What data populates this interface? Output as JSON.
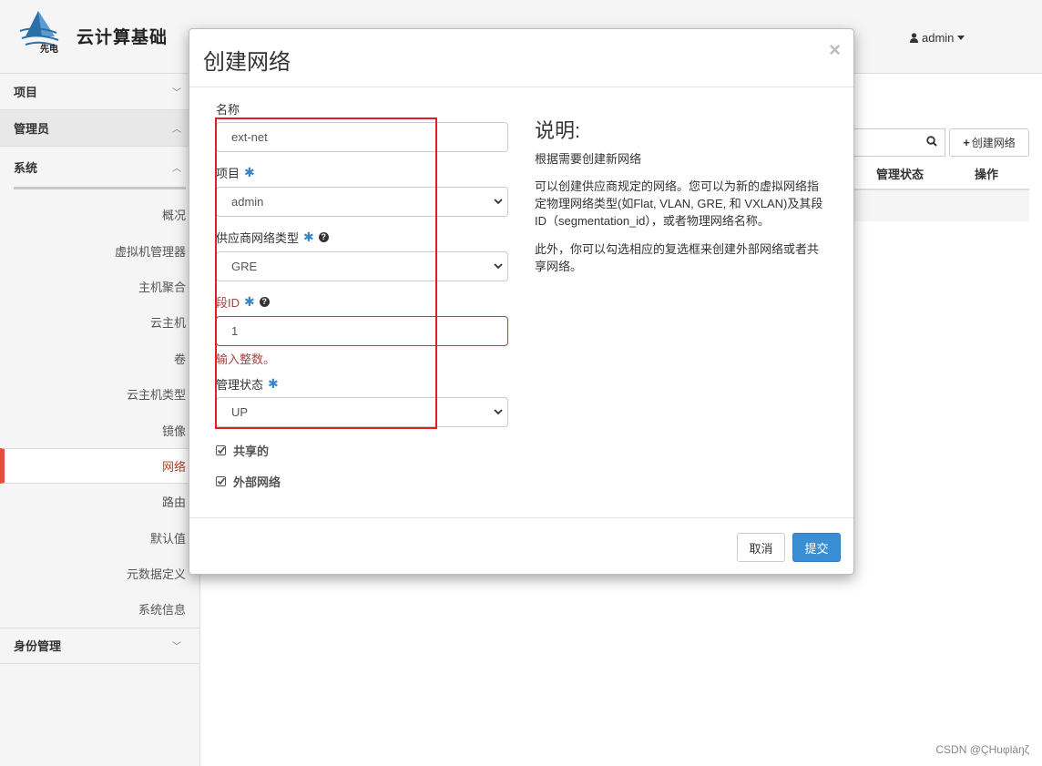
{
  "header": {
    "brand_text": "云计算基础",
    "logo_text": "先电",
    "user": "admin",
    "user_icon": "user-icon"
  },
  "sidebar": {
    "project": "项目",
    "admin": "管理员",
    "system": "系统",
    "items": [
      "概况",
      "虚拟机管理器",
      "主机聚合",
      "云主机",
      "卷",
      "云主机类型",
      "镜像",
      "网络",
      "路由",
      "默认值",
      "元数据定义",
      "系统信息"
    ],
    "active_item": "网络",
    "identity": "身份管理"
  },
  "main": {
    "create_button": "创建网络",
    "columns": [
      "管理状态",
      "操作"
    ]
  },
  "modal": {
    "title": "创建网络",
    "close": "×",
    "fields": {
      "name": {
        "label": "名称",
        "value": "ext-net"
      },
      "project": {
        "label": "项目",
        "value": "admin"
      },
      "provider_type": {
        "label": "供应商网络类型",
        "value": "GRE"
      },
      "segment_id": {
        "label": "段ID",
        "value": "1",
        "error": "输入整数。"
      },
      "admin_state": {
        "label": "管理状态",
        "value": "UP"
      }
    },
    "checkboxes": {
      "shared": "共享的",
      "external": "外部网络"
    },
    "description": {
      "title": "说明:",
      "subtitle": "根据需要创建新网络",
      "p1": "可以创建供应商规定的网络。您可以为新的虚拟网络指定物理网络类型(如Flat, VLAN, GRE, 和 VXLAN)及其段ID（segmentation_id），或者物理网络名称。",
      "p2": "此外，你可以勾选相应的复选框来创建外部网络或者共享网络。"
    },
    "buttons": {
      "cancel": "取消",
      "submit": "提交"
    }
  },
  "watermark": "CSDN @ÇHuφlàŋζ",
  "colors": {
    "accent": "#3a8ed4",
    "error": "#a94442",
    "active_nav": "#e74c3c",
    "highlight_box": "#e02020"
  }
}
